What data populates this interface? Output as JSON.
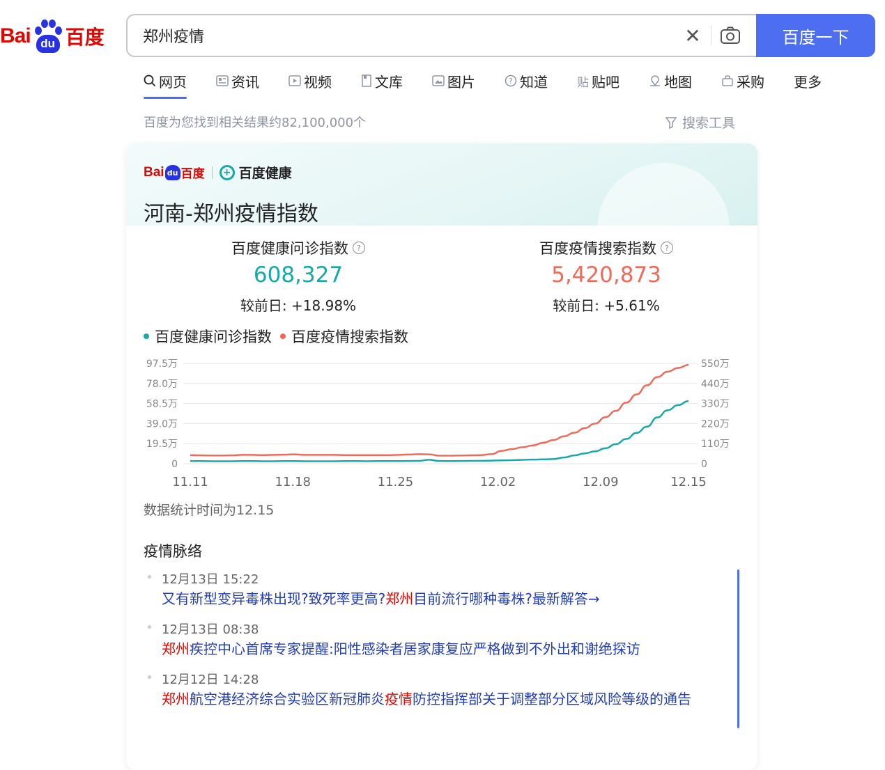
{
  "logo": {
    "bai": "Bai",
    "paw": "du",
    "cn": "百度"
  },
  "search": {
    "query": "郑州疫情",
    "button": "百度一下"
  },
  "tabs": [
    {
      "label": "网页",
      "icon": "search-icon",
      "active": true
    },
    {
      "label": "资讯",
      "icon": "news-icon"
    },
    {
      "label": "视频",
      "icon": "video-icon"
    },
    {
      "label": "文库",
      "icon": "doc-icon"
    },
    {
      "label": "图片",
      "icon": "image-icon"
    },
    {
      "label": "知道",
      "icon": "question-icon"
    },
    {
      "label": "贴吧",
      "icon": "tieba-icon"
    },
    {
      "label": "地图",
      "icon": "map-icon"
    },
    {
      "label": "采购",
      "icon": "purchase-icon"
    },
    {
      "label": "更多"
    }
  ],
  "result_stats": "百度为您找到相关结果约82,100,000个",
  "search_tools": "搜索工具",
  "card": {
    "brand": {
      "bai": "Bai",
      "paw": "du",
      "cn": "百度",
      "health": "百度健康"
    },
    "title": "河南-郑州疫情指数",
    "metrics": [
      {
        "label": "百度健康问诊指数",
        "value": "608,327",
        "change_label": "较前日:",
        "change": "+18.98%",
        "color": "#18a9a7"
      },
      {
        "label": "百度疫情搜索指数",
        "value": "5,420,873",
        "change_label": "较前日:",
        "change": "+5.61%",
        "color": "#f06a5a"
      }
    ],
    "chart_note": "数据统计时间为12.15",
    "timeline_title": "疫情脉络",
    "timeline": [
      {
        "time": "12月13日 15:22",
        "parts": [
          {
            "t": "又有新型变异毒株出现?致死率更高?"
          },
          {
            "t": "郑州",
            "hl": true
          },
          {
            "t": "目前流行哪种毒株?最新解答→"
          }
        ]
      },
      {
        "time": "12月13日 08:38",
        "parts": [
          {
            "t": "郑州",
            "hl": true
          },
          {
            "t": "疾控中心首席专家提醒:阳性感染者居家康复应严格做到不外出和谢绝探访"
          }
        ]
      },
      {
        "time": "12月12日 14:28",
        "parts": [
          {
            "t": "郑州",
            "hl": true
          },
          {
            "t": "航空港经济综合实验区新冠肺炎"
          },
          {
            "t": "疫情",
            "hl": true
          },
          {
            "t": "防控指挥部关于调整部分区域风险等级的通告"
          }
        ]
      }
    ]
  },
  "chart_data": {
    "type": "line",
    "legend": [
      "百度健康问诊指数",
      "百度疫情搜索指数"
    ],
    "x_ticks": [
      "11.11",
      "11.18",
      "11.25",
      "12.02",
      "12.09",
      "12.15"
    ],
    "y_left_ticks": [
      "0",
      "19.5万",
      "39.0万",
      "58.5万",
      "78.0万",
      "97.5万"
    ],
    "y_right_ticks": [
      "0",
      "110万",
      "220万",
      "330万",
      "440万",
      "550万"
    ],
    "ylim_left": [
      0,
      975000
    ],
    "ylim_right": [
      0,
      5500000
    ],
    "series": [
      {
        "name": "百度健康问诊指数",
        "axis": "left",
        "color": "#18a9a7",
        "values": [
          25000,
          25000,
          24000,
          24000,
          24000,
          25000,
          25000,
          24000,
          24000,
          25000,
          25000,
          24000,
          24000,
          24000,
          24000,
          25000,
          25000,
          24000,
          25000,
          25000,
          25000,
          26000,
          27000,
          38000,
          26000,
          25000,
          26000,
          27000,
          28000,
          30000,
          32000,
          34000,
          37000,
          40000,
          42000,
          45000,
          60000,
          80000,
          100000,
          120000,
          150000,
          190000,
          240000,
          300000,
          360000,
          450000,
          520000,
          570000,
          608327
        ]
      },
      {
        "name": "百度疫情搜索指数",
        "axis": "right",
        "color": "#f06a5a",
        "values": [
          470000,
          460000,
          450000,
          450000,
          460000,
          480000,
          480000,
          470000,
          480000,
          490000,
          510000,
          480000,
          480000,
          480000,
          480000,
          470000,
          470000,
          470000,
          470000,
          470000,
          480000,
          500000,
          520000,
          510000,
          440000,
          440000,
          450000,
          460000,
          470000,
          520000,
          700000,
          800000,
          900000,
          1000000,
          1150000,
          1300000,
          1500000,
          1700000,
          1950000,
          2200000,
          2550000,
          2900000,
          3350000,
          3800000,
          4300000,
          4750000,
          5050000,
          5250000,
          5420873
        ]
      }
    ]
  }
}
